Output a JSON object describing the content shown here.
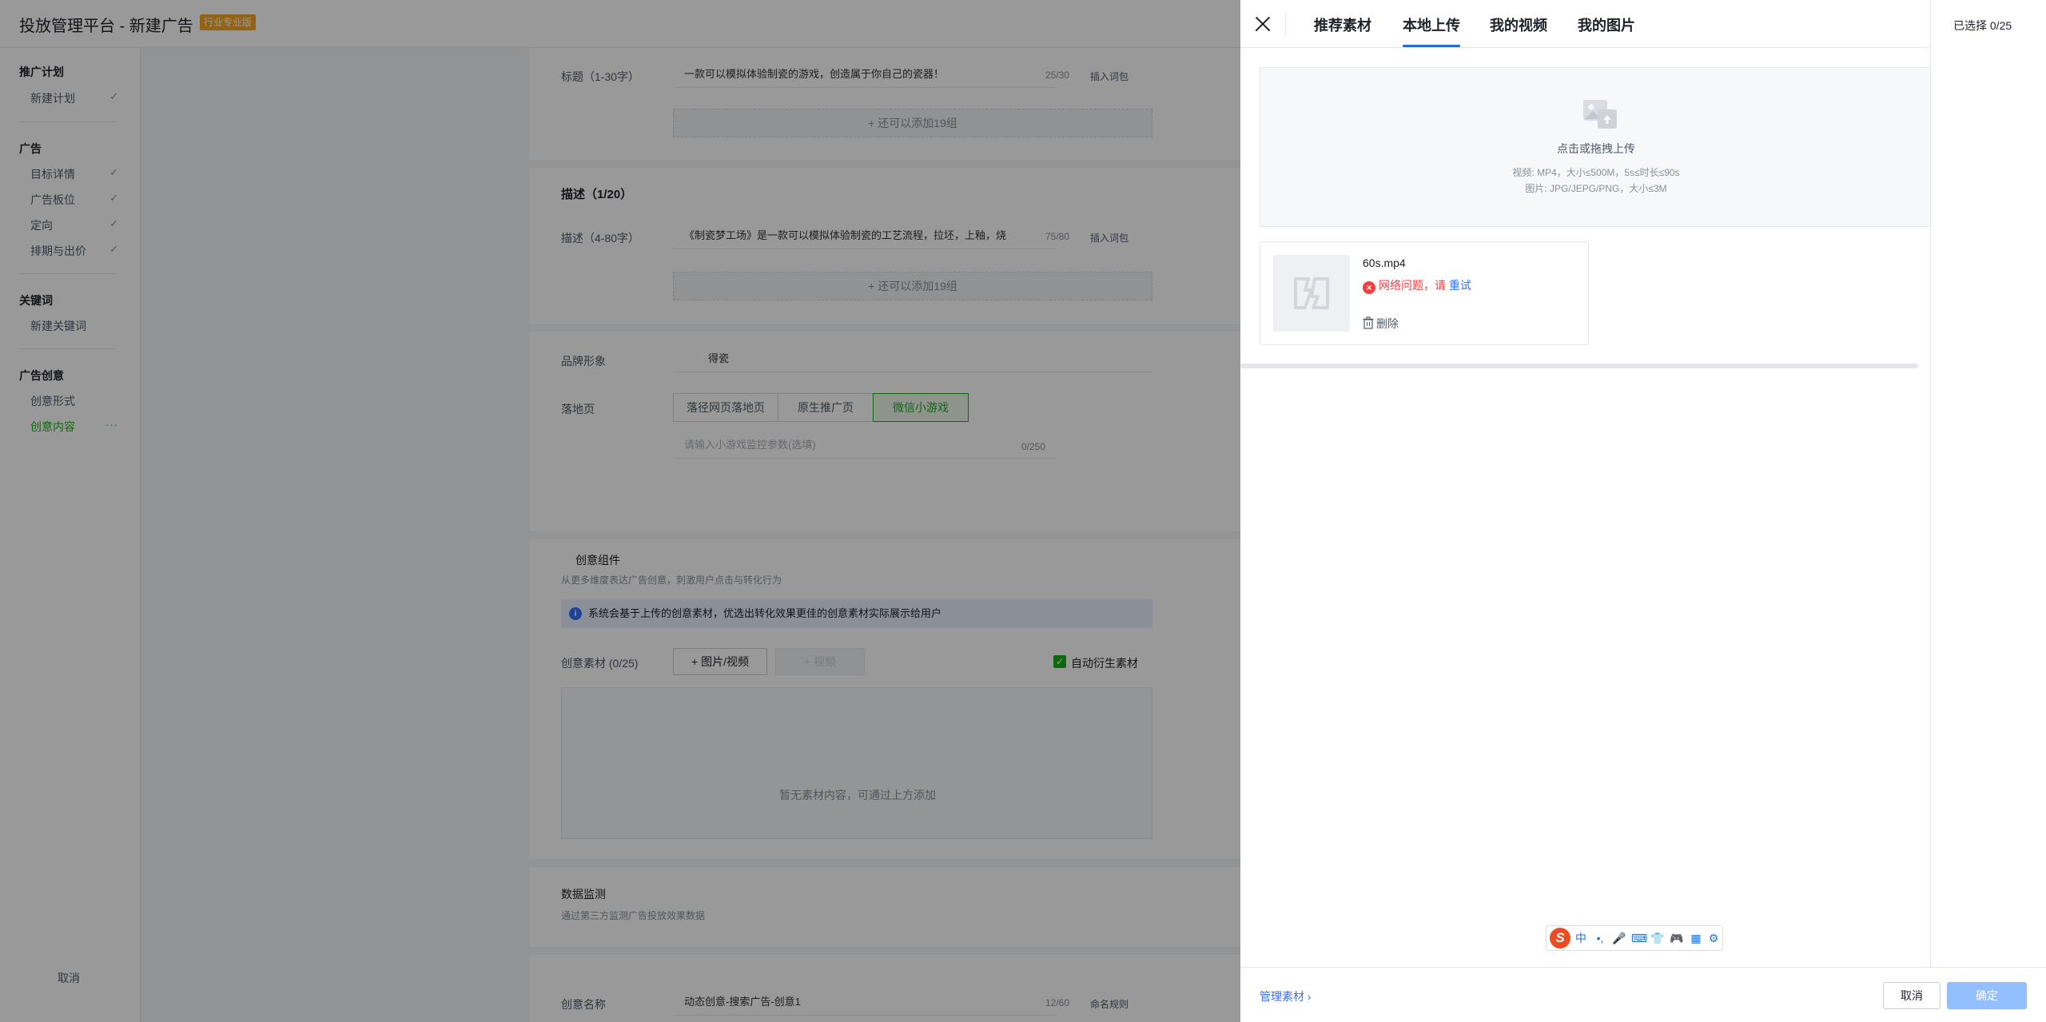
{
  "app": {
    "title": "投放管理平台 - 新建广告",
    "badge": "行业专业版"
  },
  "nav": {
    "groups": [
      {
        "label": "推广计划",
        "items": [
          {
            "label": "新建计划",
            "mark": "✓"
          }
        ]
      },
      {
        "label": "广告",
        "items": [
          {
            "label": "目标详情",
            "mark": "✓"
          },
          {
            "label": "广告板位",
            "mark": "✓"
          },
          {
            "label": "定向",
            "mark": "✓"
          },
          {
            "label": "排期与出价",
            "mark": "✓"
          }
        ]
      },
      {
        "label": "关键词",
        "items": [
          {
            "label": "新建关键词",
            "mark": ""
          }
        ]
      },
      {
        "label": "广告创意",
        "items": [
          {
            "label": "创意形式",
            "mark": ""
          },
          {
            "label": "创意内容",
            "mark": "···"
          }
        ]
      }
    ],
    "cancel": "取消"
  },
  "form": {
    "title_label": "标题（1-30字）",
    "title_value": "一款可以模拟体验制瓷的游戏，创造属于你自己的瓷器！",
    "title_count": "25/30",
    "insert_word": "插入词包",
    "add_group": "+ 还可以添加19组",
    "desc_section": "描述（1/20）",
    "desc_label": "描述（4-80字）",
    "desc_value": "《制瓷梦工场》是一款可以模拟体验制瓷的工艺流程，拉坯，上釉，烧",
    "desc_count": "75/80",
    "brand_label": "品牌形象",
    "brand_value": "得瓷",
    "landing_label": "落地页",
    "landing_options": [
      "落径网页落地页",
      "原生推广页",
      "微信小游戏"
    ],
    "landing_param_placeholder": "请输入小游戏监控参数(选填)",
    "landing_param_count": "0/250",
    "component_title": "创意组件",
    "component_desc": "从更多维度表达广告创意，刺激用户点击与转化行为",
    "info_text": "系统会基于上传的创意素材，优选出转化效果更佳的创意素材实际展示给用户",
    "material_label": "创意素材 (0/25)",
    "add_material": "+ 图片/视频",
    "add_disabled": "+ 视频",
    "auto_derive": "自动衍生素材",
    "empty_text": "暂无素材内容，可通过上方添加",
    "monitor_title": "数据监测",
    "monitor_desc": "通过第三方监测广告投放效果数据",
    "creative_name_label": "创意名称",
    "creative_name_value": "动态创意-搜索广告-创意1",
    "creative_name_count": "12/60",
    "naming_rule": "命名规则"
  },
  "drawer": {
    "tabs": [
      "推荐素材",
      "本地上传",
      "我的视频",
      "我的图片"
    ],
    "active_tab": 1,
    "selected": "已选择 0/25",
    "upload": {
      "title": "点击或拖拽上传",
      "spec_video": "视频: MP4，大小≤500M，5s≤时长≤90s",
      "spec_image": "图片: JPG/JEPG/PNG，大小≤3M"
    },
    "file": {
      "name": "60s.mp4",
      "error_text": "网络问题，请",
      "retry": "重试",
      "delete": "删除"
    },
    "ime": {
      "logo": "S",
      "items": [
        "中",
        "•,",
        "🎤",
        "⌨",
        "👕",
        "🎮",
        "▦",
        "⚙"
      ]
    },
    "footer": {
      "manage": "管理素材 ›",
      "cancel": "取消",
      "confirm": "确定"
    },
    "colors": {
      "primary": "#1f6fd8",
      "error": "#f53f3f",
      "confirm_disabled": "#94bfff",
      "brand_green": "#1aad19"
    }
  }
}
